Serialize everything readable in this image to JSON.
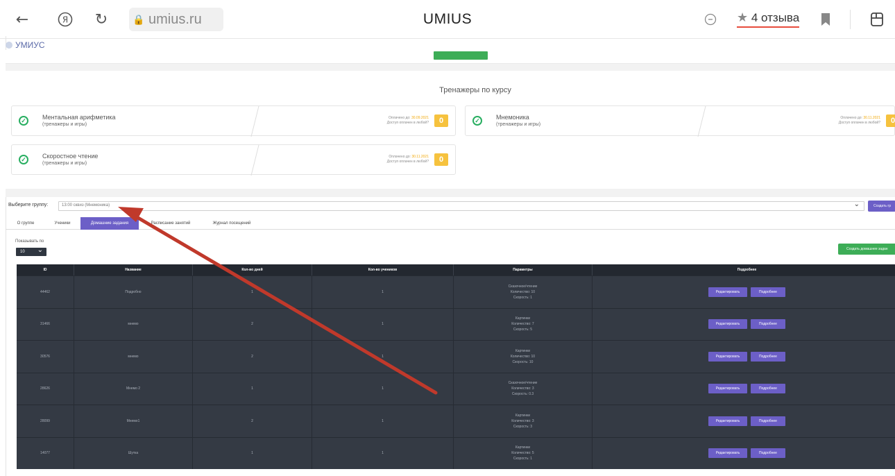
{
  "browser": {
    "url": "umius.ru",
    "title": "UMIUS",
    "reviews": "4 отзыва",
    "star": "★"
  },
  "site": {
    "logo": "УМИУС"
  },
  "trainers": {
    "title": "Тренажеры по курсу",
    "courses": [
      {
        "name": "Ментальная арифметика",
        "sub": "(тренажеры и игры)",
        "info1": "Оплачено до: ",
        "info1_date": "30.09.2021",
        "info2": "Доступ оплачен в любой?",
        "badge": "0"
      },
      {
        "name": "Мнемоника",
        "sub": "(тренажеры и игры)",
        "info1": "Оплачено до: ",
        "info1_date": "30.11.2021",
        "info2": "Доступ оплачен в любой?",
        "badge": "0"
      },
      {
        "name": "Скоростное чтение",
        "sub": "(тренажеры и игры)",
        "info1": "Оплачено до: ",
        "info1_date": "30.11.2021",
        "info2": "Доступ оплачен в любой?",
        "badge": "0"
      }
    ]
  },
  "group": {
    "label": "Выберите группу:",
    "selected": "13:00 сквиз (Мнемоника)",
    "create_button": "Создать гр"
  },
  "tabs": [
    "О группе",
    "Ученики",
    "Домашние задания",
    "Расписание занятий",
    "Журнал посещений"
  ],
  "per_page": {
    "label": "Показывать по",
    "value": "10"
  },
  "create_homework_button": "Создать домашнее задан",
  "table": {
    "headers": [
      "ID",
      "Название",
      "Кол-во дней",
      "Кол-во учеников",
      "Параметры",
      "Подробнее"
    ],
    "rows": [
      {
        "id": "44462",
        "name": "Подробно",
        "days": "1",
        "students": "1",
        "params": [
          "Сказочное/чтение",
          "Количество: 10",
          "Скорость: 1"
        ]
      },
      {
        "id": "31466",
        "name": "мнемо",
        "days": "2",
        "students": "1",
        "params": [
          "Картинки",
          "Количество: 7",
          "Скорость: 5"
        ]
      },
      {
        "id": "30576",
        "name": "мнемо",
        "days": "2",
        "students": "1",
        "params": [
          "Картинки",
          "Количество: 10",
          "Скорость: 10"
        ]
      },
      {
        "id": "28626",
        "name": "Мнемо 2",
        "days": "1",
        "students": "1",
        "params": [
          "Сказочное/чтение",
          "Количество: 3",
          "Скорость: 0.3"
        ]
      },
      {
        "id": "28099",
        "name": "Мнемо1",
        "days": "2",
        "students": "1",
        "params": [
          "Картинки",
          "Количество: 3",
          "Скорость: 3"
        ]
      },
      {
        "id": "14077",
        "name": "Шутка",
        "days": "1",
        "students": "1",
        "params": [
          "Картинки",
          "Количество: 5",
          "Скорость: 1"
        ]
      }
    ],
    "edit_label": "Редактировать",
    "details_label": "Подробнее"
  },
  "colors": {
    "accent": "#6c5fc7",
    "green": "#3dad57",
    "table_bg": "#343a44",
    "arrow": "#c0392b"
  }
}
